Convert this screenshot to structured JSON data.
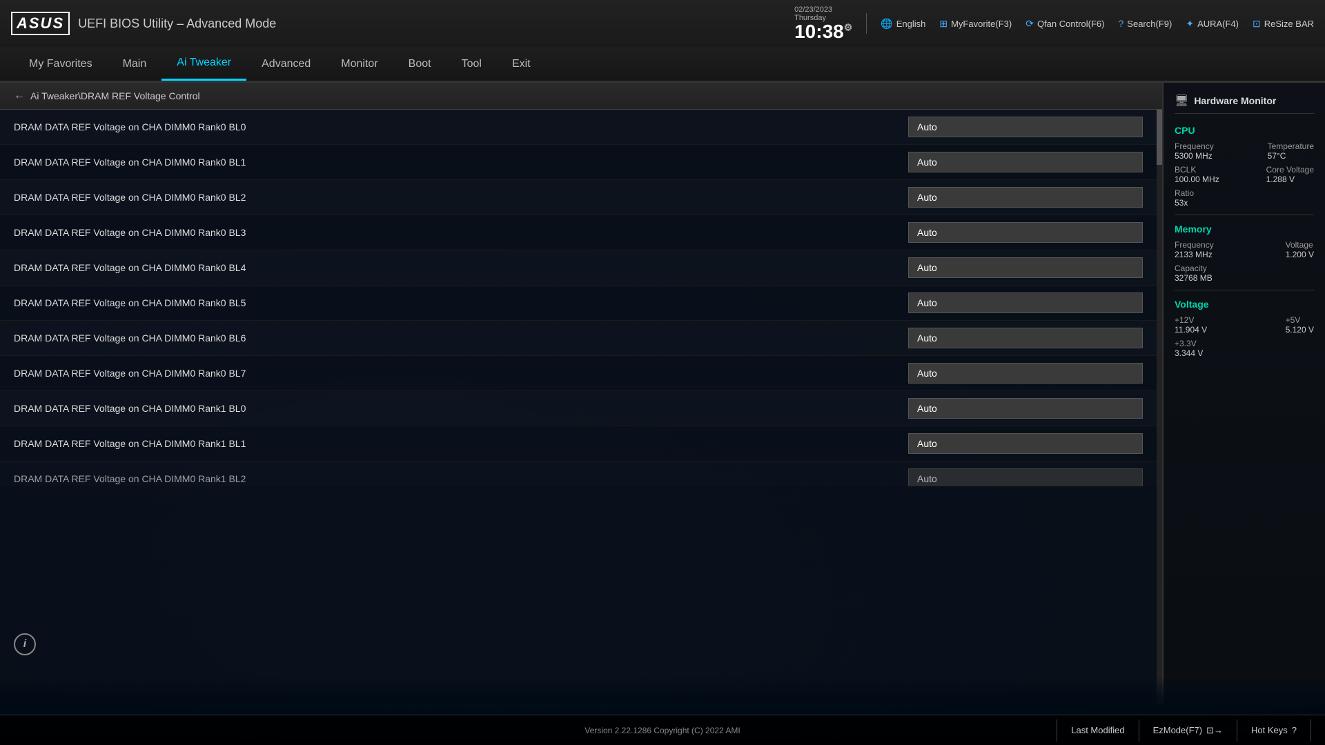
{
  "logo": {
    "brand": "ASUS",
    "title": "UEFI BIOS Utility – Advanced Mode"
  },
  "header": {
    "date": "02/23/2023",
    "day": "Thursday",
    "time": "10:38",
    "tools": [
      {
        "id": "language",
        "icon": "🌐",
        "label": "English"
      },
      {
        "id": "myfavorite",
        "icon": "⊞",
        "label": "MyFavorite(F3)"
      },
      {
        "id": "qfan",
        "icon": "⟳",
        "label": "Qfan Control(F6)"
      },
      {
        "id": "search",
        "icon": "?",
        "label": "Search(F9)"
      },
      {
        "id": "aura",
        "icon": "✦",
        "label": "AURA(F4)"
      },
      {
        "id": "resize",
        "icon": "⊡",
        "label": "ReSize BAR"
      }
    ]
  },
  "nav": {
    "items": [
      {
        "id": "my-favorites",
        "label": "My Favorites",
        "active": false
      },
      {
        "id": "main",
        "label": "Main",
        "active": false
      },
      {
        "id": "ai-tweaker",
        "label": "Ai Tweaker",
        "active": true
      },
      {
        "id": "advanced",
        "label": "Advanced",
        "active": false
      },
      {
        "id": "monitor",
        "label": "Monitor",
        "active": false
      },
      {
        "id": "boot",
        "label": "Boot",
        "active": false
      },
      {
        "id": "tool",
        "label": "Tool",
        "active": false
      },
      {
        "id": "exit",
        "label": "Exit",
        "active": false
      }
    ]
  },
  "breadcrumb": {
    "text": "Ai Tweaker\\DRAM REF Voltage Control"
  },
  "settings": [
    {
      "label": "DRAM DATA REF Voltage on CHA DIMM0 Rank0 BL0",
      "value": "Auto"
    },
    {
      "label": "DRAM DATA REF Voltage on CHA DIMM0 Rank0 BL1",
      "value": "Auto"
    },
    {
      "label": "DRAM DATA REF Voltage on CHA DIMM0 Rank0 BL2",
      "value": "Auto"
    },
    {
      "label": "DRAM DATA REF Voltage on CHA DIMM0 Rank0 BL3",
      "value": "Auto"
    },
    {
      "label": "DRAM DATA REF Voltage on CHA DIMM0 Rank0 BL4",
      "value": "Auto"
    },
    {
      "label": "DRAM DATA REF Voltage on CHA DIMM0 Rank0 BL5",
      "value": "Auto"
    },
    {
      "label": "DRAM DATA REF Voltage on CHA DIMM0 Rank0 BL6",
      "value": "Auto"
    },
    {
      "label": "DRAM DATA REF Voltage on CHA DIMM0 Rank0 BL7",
      "value": "Auto"
    },
    {
      "label": "DRAM DATA REF Voltage on CHA DIMM0 Rank1 BL0",
      "value": "Auto"
    },
    {
      "label": "DRAM DATA REF Voltage on CHA DIMM0 Rank1 BL1",
      "value": "Auto"
    },
    {
      "label": "DRAM DATA REF Voltage on CHA DIMM0 Rank1 BL2",
      "value": "Auto"
    }
  ],
  "hardware_monitor": {
    "title": "Hardware Monitor",
    "cpu": {
      "section": "CPU",
      "frequency_label": "Frequency",
      "frequency_value": "5300 MHz",
      "temperature_label": "Temperature",
      "temperature_value": "57°C",
      "bclk_label": "BCLK",
      "bclk_value": "100.00 MHz",
      "core_voltage_label": "Core Voltage",
      "core_voltage_value": "1.288 V",
      "ratio_label": "Ratio",
      "ratio_value": "53x"
    },
    "memory": {
      "section": "Memory",
      "frequency_label": "Frequency",
      "frequency_value": "2133 MHz",
      "voltage_label": "Voltage",
      "voltage_value": "1.200 V",
      "capacity_label": "Capacity",
      "capacity_value": "32768 MB"
    },
    "voltage": {
      "section": "Voltage",
      "v12_label": "+12V",
      "v12_value": "11.904 V",
      "v5_label": "+5V",
      "v5_value": "5.120 V",
      "v33_label": "+3.3V",
      "v33_value": "3.344 V"
    }
  },
  "footer": {
    "version": "Version 2.22.1286 Copyright (C) 2022 AMI",
    "last_modified": "Last Modified",
    "ez_mode": "EzMode(F7)",
    "hot_keys": "Hot Keys"
  }
}
